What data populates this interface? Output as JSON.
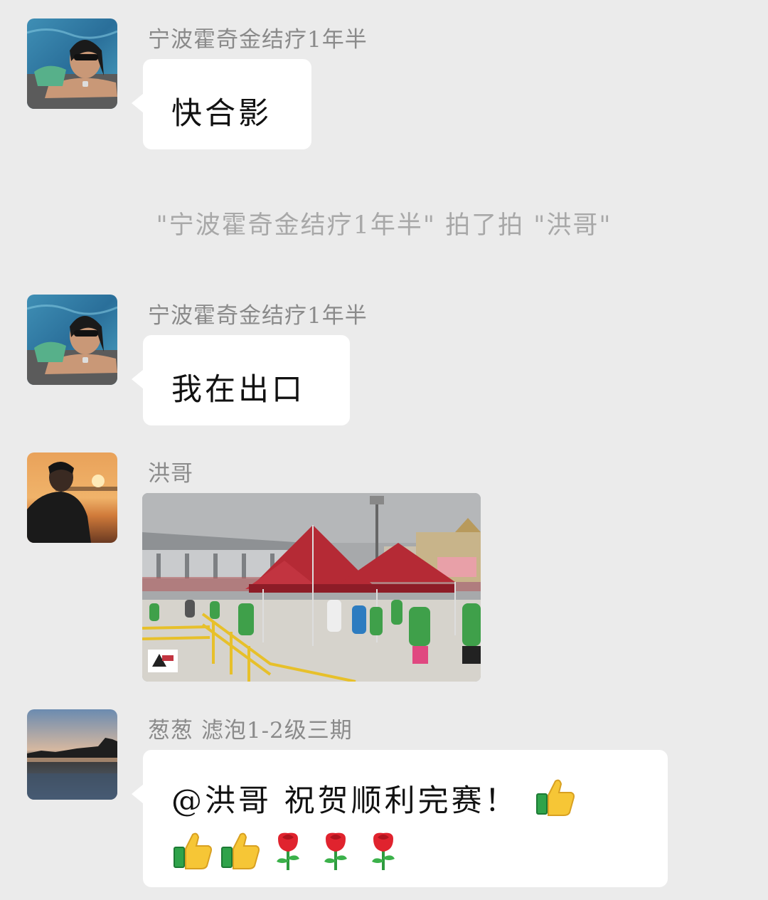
{
  "messages": [
    {
      "sender": "宁波霍奇金结疗1年半",
      "text": "快合影",
      "avatar": "woman-in-pool-avatar"
    },
    {
      "system": "\"宁波霍奇金结疗1年半\" 拍了拍 \"洪哥\""
    },
    {
      "sender": "宁波霍奇金结疗1年半",
      "text": "我在出口",
      "avatar": "woman-in-pool-avatar"
    },
    {
      "sender": "洪哥",
      "avatar": "man-at-sunset-avatar",
      "image": "marathon-finish-area-photo"
    },
    {
      "sender": "葱葱  滤泡1-2级三期",
      "avatar": "lake-sunset-avatar",
      "text": "@洪哥  祝贺顺利完赛！",
      "emojis_inline": [
        "thumbs-up-icon"
      ],
      "emojis_line2": [
        "thumbs-up-icon",
        "thumbs-up-icon",
        "rose-icon",
        "rose-icon",
        "rose-icon"
      ]
    }
  ],
  "colors": {
    "background": "#ebebeb",
    "bubble": "#ffffff",
    "sender_text": "#8a8a8a",
    "system_text": "#a8a8a8"
  }
}
